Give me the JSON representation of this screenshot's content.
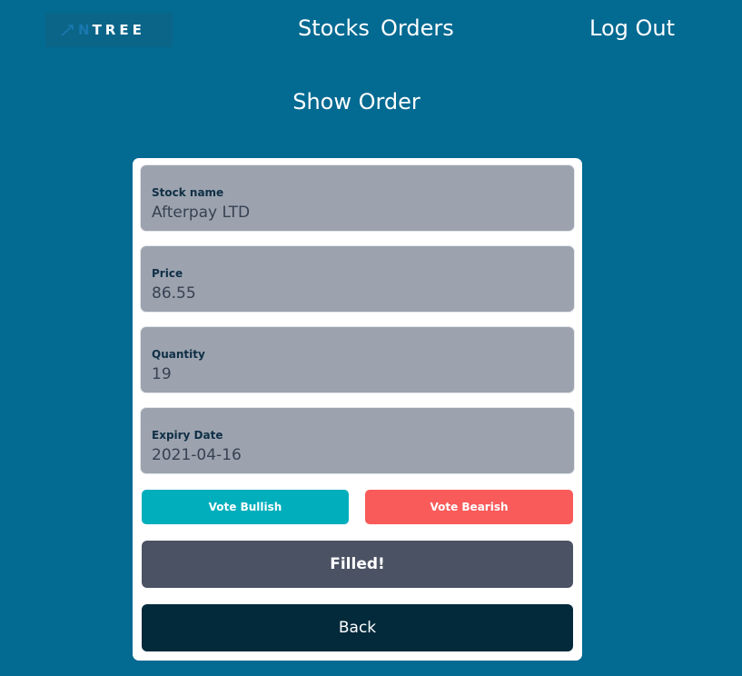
{
  "nav": {
    "logo_prefix": "N",
    "logo_text": "TREE",
    "links": [
      "Stocks",
      "Orders"
    ],
    "logout": "Log Out"
  },
  "page": {
    "title": "Show Order"
  },
  "order": {
    "fields": [
      {
        "label": "Stock name",
        "value": "Afterpay LTD"
      },
      {
        "label": "Price",
        "value": "86.55"
      },
      {
        "label": "Quantity",
        "value": "19"
      },
      {
        "label": "Expiry Date",
        "value": "2021-04-16"
      }
    ],
    "vote_bullish": "Vote Bullish",
    "vote_bearish": "Vote Bearish",
    "status": "Filled!",
    "back": "Back"
  },
  "colors": {
    "background": "#036a92",
    "bullish": "#01aebc",
    "bearish": "#f95a5a",
    "status": "#4b5263",
    "back": "#022a3b",
    "field": "#9ca3af"
  },
  "icons": {
    "logo": "trend-arrow-icon"
  }
}
